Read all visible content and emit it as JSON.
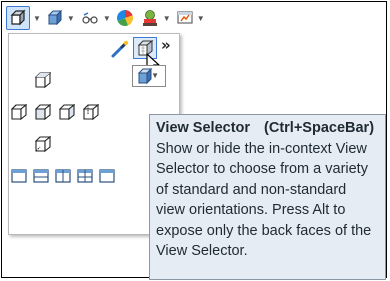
{
  "toolbar": {
    "items": [
      {
        "icon": "view-orientation-cube-icon",
        "active": true,
        "has_dropdown": true
      },
      {
        "icon": "display-style-cube-icon",
        "active": false,
        "has_dropdown": true
      },
      {
        "icon": "hide-show-items-icon",
        "active": false,
        "has_dropdown": true
      },
      {
        "icon": "edit-appearance-icon",
        "active": false,
        "has_dropdown": false
      },
      {
        "icon": "apply-scene-icon",
        "active": false,
        "has_dropdown": true
      },
      {
        "icon": "view-settings-icon",
        "active": false,
        "has_dropdown": true
      }
    ]
  },
  "flyout": {
    "more_label": "»",
    "pin_icon": "new-view-icon",
    "view_selector_icon": "view-selector-cube-icon"
  },
  "tooltip": {
    "title": "View Selector",
    "shortcut": "(Ctrl+SpaceBar)",
    "description": "Show or hide the in-context View Selector to choose from a variety of standard and non-standard view orientations. Press Alt to expose only the back faces of the View Selector."
  },
  "colors": {
    "accent": "#3e7bd6",
    "tooltip_bg": "#e5ecf3",
    "tooltip_border": "#8c98a4"
  }
}
